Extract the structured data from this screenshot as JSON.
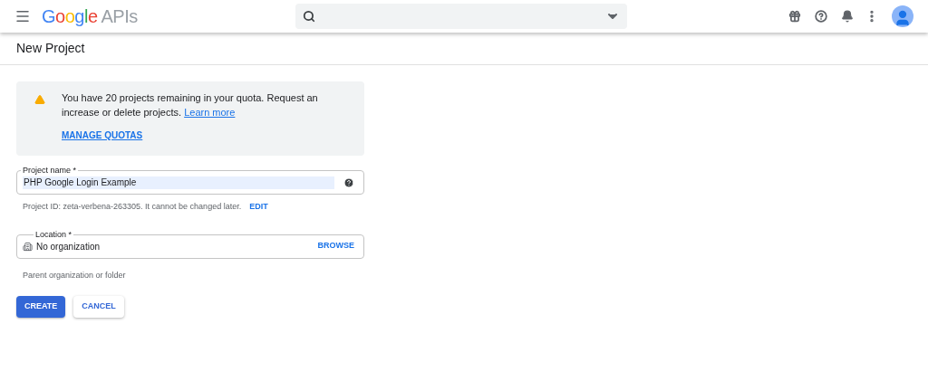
{
  "header": {
    "logo": "Google",
    "product": "APIs"
  },
  "page_title": "New Project",
  "notice": {
    "text": "You have 20 projects remaining in your quota. Request an increase or delete projects.",
    "link": "Learn more",
    "action": "MANAGE QUOTAS"
  },
  "project_name": {
    "label": "Project name *",
    "value": "PHP Google Login Example",
    "hint": "Project ID: zeta-verbena-263305. It cannot be changed later.",
    "hint_action": "EDIT"
  },
  "location": {
    "label": "Location *",
    "value": "No organization",
    "action": "BROWSE",
    "hint": "Parent organization or folder"
  },
  "buttons": [
    {
      "label": "CREATE",
      "kind": "primary"
    },
    {
      "label": "CANCEL",
      "kind": "secondary"
    }
  ]
}
